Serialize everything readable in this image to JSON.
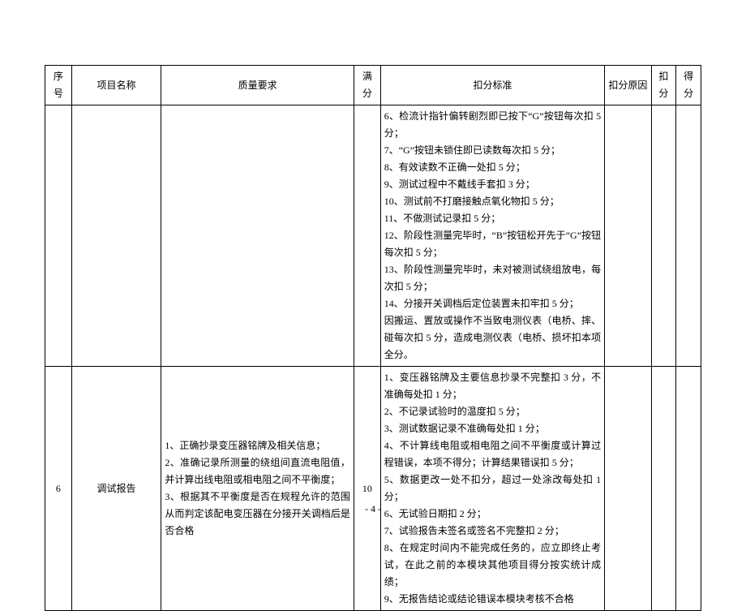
{
  "headers": {
    "seq": "序号",
    "name": "项目名称",
    "req": "质量要求",
    "full": "满分",
    "ded": "扣分标准",
    "reason": "扣分原因",
    "kf": "扣分",
    "df": "得分"
  },
  "row1": {
    "ded": {
      "i6": "6、检流计指针偏转剧烈即已按下“G”按钮每次扣 5 分；",
      "i7": "7、“G”按钮未锁住即已读数每次扣 5 分；",
      "i8": "8、有效读数不正确一处扣 5 分；",
      "i9": "9、测试过程中不戴线手套扣 3 分；",
      "i10": "10、测试前不打磨接触点氧化物扣 5 分；",
      "i11": "11、不做测试记录扣 5 分；",
      "i12": "12、阶段性测量完毕时，“B”按钮松开先于“G”按钮每次扣 5 分；",
      "i13": "13、阶段性测量完毕时，未对被测试绕组放电，每次扣 5 分；",
      "i14": "14、分接开关调档后定位装置未扣牢扣 5 分；",
      "i15": "因搬运、置放或操作不当致电测仪表（电桥、摔、碰每次扣 5 分，造成电测仪表（电桥、损坏扣本项全分。"
    }
  },
  "row2": {
    "seq": "6",
    "name": "调试报告",
    "req": {
      "i1": "1、正确抄录变压器铭牌及相关信息；",
      "i2": "2、准确记录所测量的绕组间直流电阻值，并计算出线电阻或相电阻之间不平衡度；",
      "i3": "3、根据其不平衡度是否在规程允许的范围从而判定该配电变压器在分接开关调档后是否合格"
    },
    "full": "10",
    "ded": {
      "i1": "1、变压器铭牌及主要信息抄录不完整扣 3 分，不准确每处扣 1 分；",
      "i2": "2、不记录试验时的温度扣 5 分；",
      "i3": "3、测试数据记录不准确每处扣 1 分；",
      "i4": "4、不计算线电阻或相电阻之间不平衡度或计算过程错误，本项不得分；计算结果错误扣 5 分；",
      "i5": "5、数据更改一处不扣分，超过一处涂改每处扣 1 分；",
      "i6": "6、无试验日期扣 2 分；",
      "i7": "7、试验报告未签名或签名不完整扣 2 分；",
      "i8": "8、在规定时间内不能完成任务的，应立即终止考试，在此之前的本模块其他项目得分按实统计成绩；",
      "i9": "9、无报告结论或结论错误本模块考核不合格"
    }
  },
  "page_number": "- 4 -"
}
